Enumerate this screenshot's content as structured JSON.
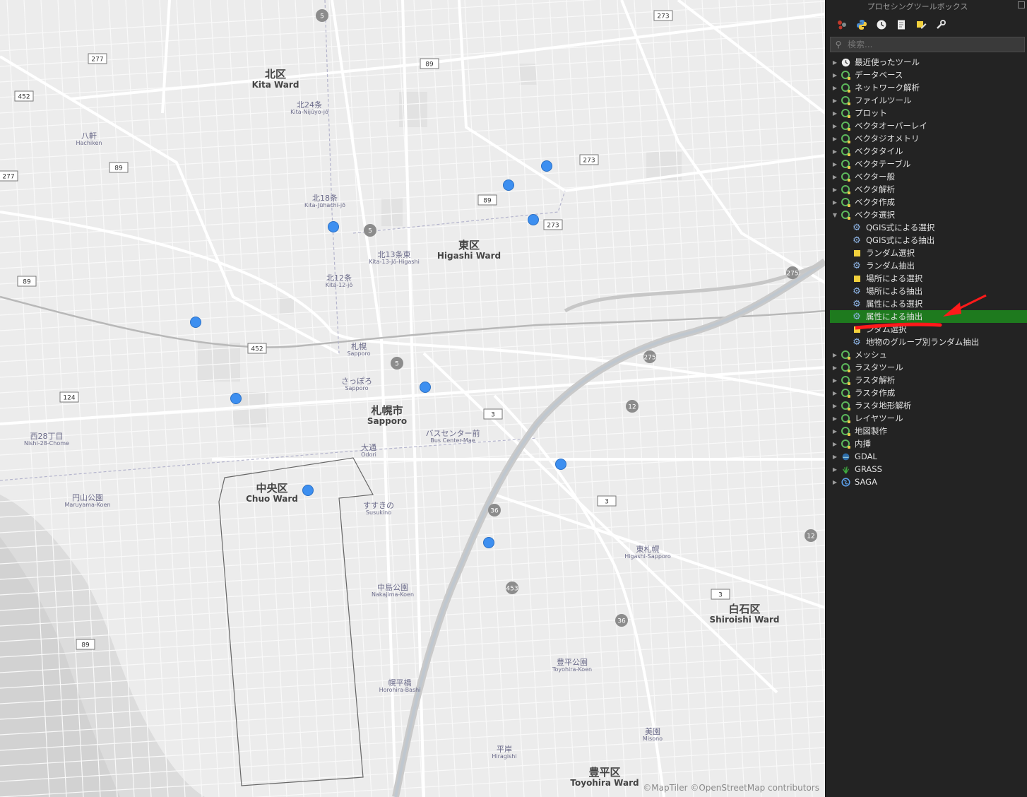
{
  "map": {
    "attribution": "©MapTiler ©OpenStreetMap contributors",
    "wards": [
      {
        "ja": "北区",
        "en": "Kita Ward"
      },
      {
        "ja": "東区",
        "en": "Higashi Ward"
      },
      {
        "ja": "札幌市",
        "en": "Sapporo"
      },
      {
        "ja": "中央区",
        "en": "Chuo Ward"
      },
      {
        "ja": "白石区",
        "en": "Shiroishi Ward"
      },
      {
        "ja": "豊平区",
        "en": "Toyohira Ward"
      }
    ],
    "stations": [
      {
        "ja": "北24条",
        "en": "Kita-Nijūyo-jō"
      },
      {
        "ja": "北18条",
        "en": "Kita-Jūhachi-jō"
      },
      {
        "ja": "北12条",
        "en": "Kita-12-jō"
      },
      {
        "ja": "北13条東",
        "en": "Kita-13-Jō-Higashi"
      },
      {
        "ja": "札幌",
        "en": "Sapporo"
      },
      {
        "ja": "さっぽろ",
        "en": "Sapporo"
      },
      {
        "ja": "八軒",
        "en": "Hachiken"
      },
      {
        "ja": "西28丁目",
        "en": "Nishi-28-Chome"
      },
      {
        "ja": "円山公園",
        "en": "Maruyama-Koen"
      },
      {
        "ja": "大通",
        "en": "Odori"
      },
      {
        "ja": "バスセンター前",
        "en": "Bus Center-Mae"
      },
      {
        "ja": "すすきの",
        "en": "Susukino"
      },
      {
        "ja": "中島公園",
        "en": "Nakajima-Koen"
      },
      {
        "ja": "幌平橋",
        "en": "Horohira-Bashi"
      },
      {
        "ja": "平岸",
        "en": "Hiragishi"
      },
      {
        "ja": "豊平公園",
        "en": "Toyohira-Koen"
      },
      {
        "ja": "東札幌",
        "en": "Higashi-Sapporo"
      },
      {
        "ja": "美園",
        "en": "Misono"
      }
    ],
    "route_shields": [
      "5",
      "5",
      "5",
      "273",
      "273",
      "273",
      "89",
      "89",
      "89",
      "89",
      "89",
      "277",
      "277",
      "452",
      "452",
      "124",
      "3",
      "3",
      "3",
      "36",
      "36",
      "453",
      "12",
      "12",
      "275",
      "275"
    ],
    "point_color": "#3d8ff0"
  },
  "panel": {
    "title": "プロセシングツールボックス",
    "toolbar_icons": [
      "models-icon",
      "python-icon",
      "history-icon",
      "results-icon",
      "edit-features-icon",
      "options-icon"
    ],
    "search_placeholder": "検索...",
    "selected_color": "#1e7a1e",
    "groups": [
      {
        "label": "最近使ったツール",
        "icon": "clock-icon",
        "expanded": false
      },
      {
        "label": "データベース",
        "icon": "qgis-icon",
        "expanded": false
      },
      {
        "label": "ネットワーク解析",
        "icon": "qgis-icon",
        "expanded": false
      },
      {
        "label": "ファイルツール",
        "icon": "qgis-icon",
        "expanded": false
      },
      {
        "label": "プロット",
        "icon": "qgis-icon",
        "expanded": false
      },
      {
        "label": "ベクタオーバーレイ",
        "icon": "qgis-icon",
        "expanded": false
      },
      {
        "label": "ベクタジオメトリ",
        "icon": "qgis-icon",
        "expanded": false
      },
      {
        "label": "ベクタタイル",
        "icon": "qgis-icon",
        "expanded": false
      },
      {
        "label": "ベクタテーブル",
        "icon": "qgis-icon",
        "expanded": false
      },
      {
        "label": "ベクター般",
        "icon": "qgis-icon",
        "expanded": false
      },
      {
        "label": "ベクタ解析",
        "icon": "qgis-icon",
        "expanded": false
      },
      {
        "label": "ベクタ作成",
        "icon": "qgis-icon",
        "expanded": false
      },
      {
        "label": "ベクタ選択",
        "icon": "qgis-icon",
        "expanded": true
      }
    ],
    "children": [
      {
        "label": "QGIS式による選択",
        "icon": "gear-icon",
        "selected": false
      },
      {
        "label": "QGIS式による抽出",
        "icon": "gear-icon",
        "selected": false
      },
      {
        "label": "ランダム選択",
        "icon": "select-icon",
        "selected": false
      },
      {
        "label": "ランダム抽出",
        "icon": "gear-icon",
        "selected": false
      },
      {
        "label": "場所による選択",
        "icon": "select-icon",
        "selected": false
      },
      {
        "label": "場所による抽出",
        "icon": "gear-icon",
        "selected": false
      },
      {
        "label": "属性による選択",
        "icon": "gear-icon",
        "selected": false
      },
      {
        "label": "属性による抽出",
        "icon": "gear-icon",
        "selected": true
      },
      {
        "label": "ンダム選択",
        "icon": "select-icon",
        "selected": false
      },
      {
        "label": "地物のグループ別ランダム抽出",
        "icon": "gear-icon",
        "selected": false
      }
    ],
    "groups_after": [
      {
        "label": "メッシュ",
        "icon": "qgis-icon"
      },
      {
        "label": "ラスタツール",
        "icon": "qgis-icon"
      },
      {
        "label": "ラスタ解析",
        "icon": "qgis-icon"
      },
      {
        "label": "ラスタ作成",
        "icon": "qgis-icon"
      },
      {
        "label": "ラスタ地形解析",
        "icon": "qgis-icon"
      },
      {
        "label": "レイヤツール",
        "icon": "qgis-icon"
      },
      {
        "label": "地図製作",
        "icon": "qgis-icon"
      },
      {
        "label": "内挿",
        "icon": "qgis-icon"
      },
      {
        "label": "GDAL",
        "icon": "gdal-icon"
      },
      {
        "label": "GRASS",
        "icon": "grass-icon"
      },
      {
        "label": "SAGA",
        "icon": "saga-icon"
      }
    ],
    "annotation_color": "#ff1a1a"
  }
}
